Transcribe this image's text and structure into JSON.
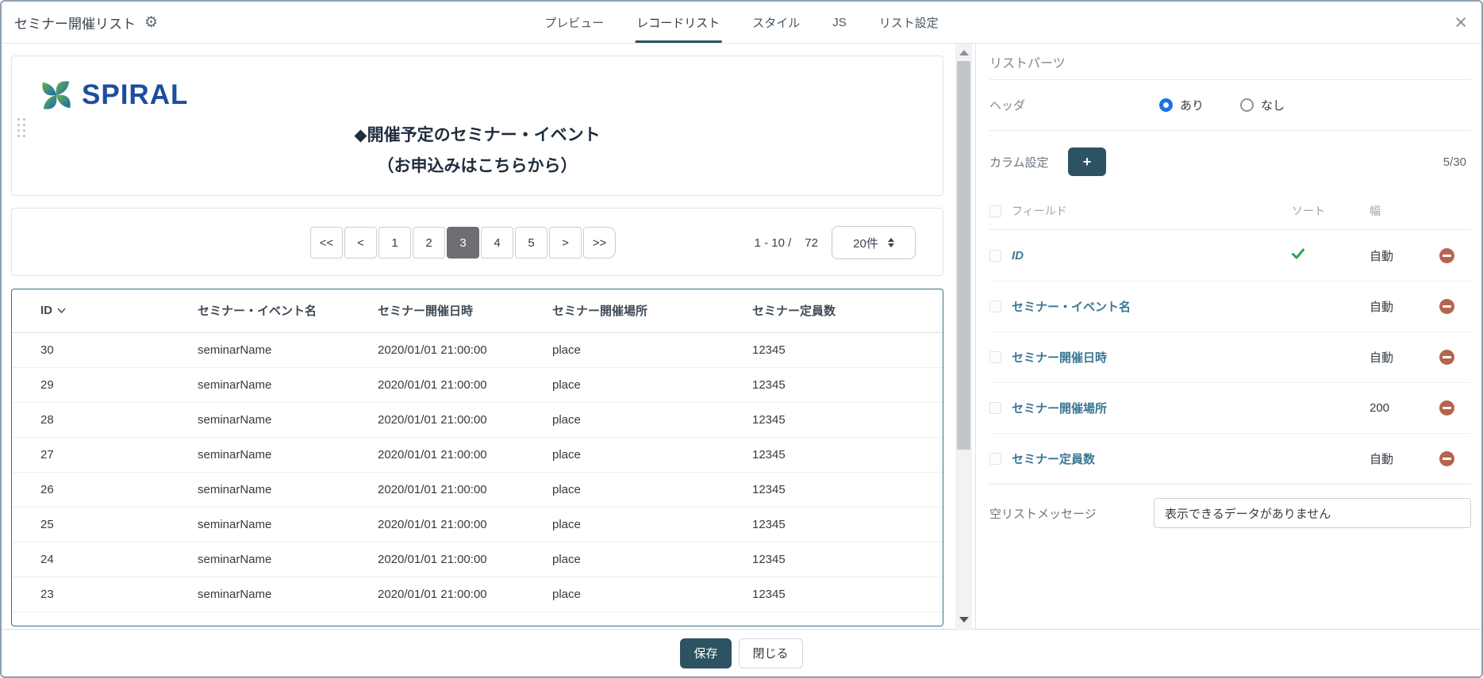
{
  "window": {
    "title": "セミナー開催リスト",
    "close_label": "×"
  },
  "tabs": [
    {
      "label": "プレビュー",
      "active": false
    },
    {
      "label": "レコードリスト",
      "active": true
    },
    {
      "label": "スタイル",
      "active": false
    },
    {
      "label": "JS",
      "active": false
    },
    {
      "label": "リスト設定",
      "active": false
    }
  ],
  "preview": {
    "logo_text": "SPIRAL",
    "heading_line1": "◆開催予定のセミナー・イベント",
    "heading_line2": "（お申込みはこちらから）"
  },
  "pagination": {
    "buttons": [
      {
        "label": "<<",
        "active": false
      },
      {
        "label": "<",
        "active": false
      },
      {
        "label": "1",
        "active": false
      },
      {
        "label": "2",
        "active": false
      },
      {
        "label": "3",
        "active": true
      },
      {
        "label": "4",
        "active": false
      },
      {
        "label": "5",
        "active": false
      },
      {
        "label": ">",
        "active": false
      },
      {
        "label": ">>",
        "active": false
      }
    ],
    "range_text": "1 - 10 /",
    "total": "72",
    "page_size": "20件"
  },
  "table": {
    "columns": [
      "ID",
      "セミナー・イベント名",
      "セミナー開催日時",
      "セミナー開催場所",
      "セミナー定員数"
    ],
    "rows": [
      {
        "id": "30",
        "name": "seminarName",
        "datetime": "2020/01/01 21:00:00",
        "place": "place",
        "capacity": "12345"
      },
      {
        "id": "29",
        "name": "seminarName",
        "datetime": "2020/01/01 21:00:00",
        "place": "place",
        "capacity": "12345"
      },
      {
        "id": "28",
        "name": "seminarName",
        "datetime": "2020/01/01 21:00:00",
        "place": "place",
        "capacity": "12345"
      },
      {
        "id": "27",
        "name": "seminarName",
        "datetime": "2020/01/01 21:00:00",
        "place": "place",
        "capacity": "12345"
      },
      {
        "id": "26",
        "name": "seminarName",
        "datetime": "2020/01/01 21:00:00",
        "place": "place",
        "capacity": "12345"
      },
      {
        "id": "25",
        "name": "seminarName",
        "datetime": "2020/01/01 21:00:00",
        "place": "place",
        "capacity": "12345"
      },
      {
        "id": "24",
        "name": "seminarName",
        "datetime": "2020/01/01 21:00:00",
        "place": "place",
        "capacity": "12345"
      },
      {
        "id": "23",
        "name": "seminarName",
        "datetime": "2020/01/01 21:00:00",
        "place": "place",
        "capacity": "12345"
      }
    ]
  },
  "panel": {
    "title": "リストパーツ",
    "header_label": "ヘッダ",
    "header_options": [
      {
        "label": "あり",
        "selected": true
      },
      {
        "label": "なし",
        "selected": false
      }
    ],
    "column_settings_label": "カラム設定",
    "add_button_label": "+",
    "count": "5/30",
    "field_columns": {
      "field": "フィールド",
      "sort": "ソート",
      "width": "幅"
    },
    "fields": [
      {
        "name": "ID",
        "sorted": true,
        "width": "自動",
        "italic": true
      },
      {
        "name": "セミナー・イベント名",
        "sorted": false,
        "width": "自動",
        "italic": false
      },
      {
        "name": "セミナー開催日時",
        "sorted": false,
        "width": "自動",
        "italic": false
      },
      {
        "name": "セミナー開催場所",
        "sorted": false,
        "width": "200",
        "italic": false
      },
      {
        "name": "セミナー定員数",
        "sorted": false,
        "width": "自動",
        "italic": false
      }
    ],
    "empty_message_label": "空リストメッセージ",
    "empty_message_value": "表示できるデータがありません"
  },
  "footer": {
    "save_label": "保存",
    "close_label": "閉じる"
  },
  "colors": {
    "accent": "#2d5362",
    "link": "#35708e",
    "field_link": "#3a7795",
    "remove": "#b5654d",
    "check": "#2ea44f",
    "radio_selected": "#1a73e8",
    "active_page_bg": "#6e6e74",
    "table_border": "#3d6e7e"
  }
}
